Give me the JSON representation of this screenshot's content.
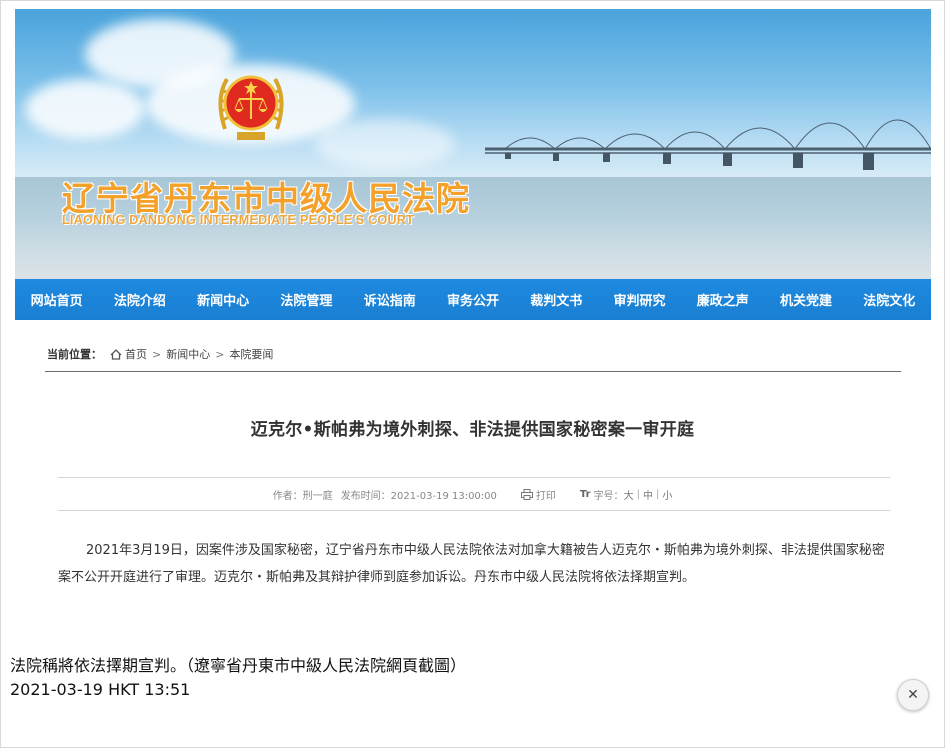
{
  "banner": {
    "title_cn": "辽宁省丹东市中级人民法院",
    "title_en": "LIAONING DANDONG INTERMEDIATE PEOPLE'S COURT",
    "emblem_icon": "court-emblem-icon",
    "colors": {
      "title": "#f4a12b",
      "nav": "#1a7fd2"
    }
  },
  "nav": {
    "items": [
      "网站首页",
      "法院介绍",
      "新闻中心",
      "法院管理",
      "诉讼指南",
      "审务公开",
      "裁判文书",
      "审判研究",
      "廉政之声",
      "机关党建",
      "法院文化"
    ]
  },
  "breadcrumb": {
    "label": "当前位置：",
    "home_icon": "home-icon",
    "items": [
      "首页",
      "新闻中心",
      "本院要闻"
    ],
    "separator": ">"
  },
  "article": {
    "title": "迈克尔•斯帕弗为境外刺探、非法提供国家秘密案一审开庭",
    "meta": {
      "author": "作者：刑一庭",
      "published": "发布时间：2021-03-19 13:00:00",
      "print_label": "打印",
      "fontsize_label": "字号：",
      "fontsize_options": [
        "大",
        "中",
        "小"
      ]
    },
    "body": "2021年3月19日，因案件涉及国家秘密，辽宁省丹东市中级人民法院依法对加拿大籍被告人迈克尔・斯帕弗为境外刺探、非法提供国家秘密案不公开开庭进行了审理。迈克尔・斯帕弗及其辩护律师到庭参加诉讼。丹东市中级人民法院将依法择期宣判。"
  },
  "caption": {
    "line1": "法院稱將依法擇期宣判。（遼寧省丹東市中級人民法院網頁截圖）",
    "line2": "2021-03-19 HKT 13:51"
  },
  "close": {
    "symbol": "✕",
    "icon": "close-icon"
  }
}
